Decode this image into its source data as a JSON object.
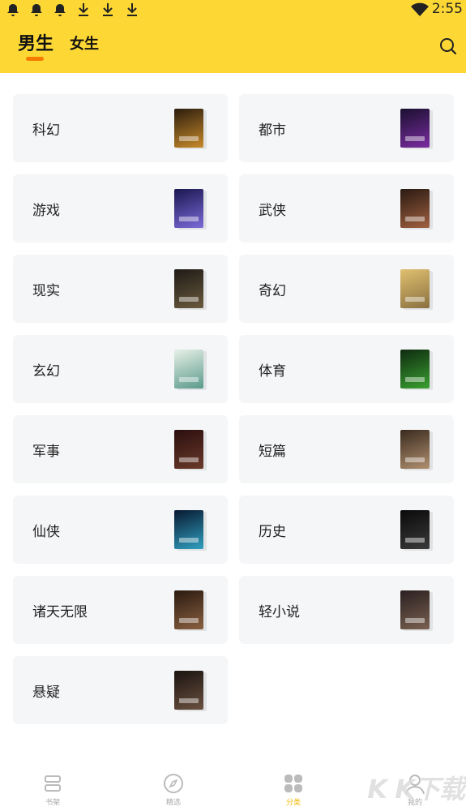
{
  "statusbar": {
    "time": "2:55"
  },
  "tabs": {
    "male": "男生",
    "female": "女生",
    "active": "male"
  },
  "colors": {
    "header": "#FDD835",
    "indicator": "#F57C00",
    "card": "#F5F6F8",
    "active_nav": "#F5B800"
  },
  "categories": [
    {
      "label": "科幻",
      "cover": [
        "#2b1d0e",
        "#c88a2a"
      ]
    },
    {
      "label": "都市",
      "cover": [
        "#1a1030",
        "#7a2ca0"
      ]
    },
    {
      "label": "游戏",
      "cover": [
        "#1b1750",
        "#7a6ad8"
      ]
    },
    {
      "label": "武侠",
      "cover": [
        "#2a1a12",
        "#a06040"
      ]
    },
    {
      "label": "现实",
      "cover": [
        "#1e1a16",
        "#6a5a3e"
      ]
    },
    {
      "label": "奇幻",
      "cover": [
        "#e0c070",
        "#8a7040"
      ]
    },
    {
      "label": "玄幻",
      "cover": [
        "#e8f0e8",
        "#5a9a8a"
      ]
    },
    {
      "label": "体育",
      "cover": [
        "#0e2a10",
        "#3aa030"
      ]
    },
    {
      "label": "军事",
      "cover": [
        "#2a0e0e",
        "#6a3a2a"
      ]
    },
    {
      "label": "短篇",
      "cover": [
        "#3a2a1e",
        "#b09070"
      ]
    },
    {
      "label": "仙侠",
      "cover": [
        "#081830",
        "#30a0c0"
      ]
    },
    {
      "label": "历史",
      "cover": [
        "#0a0a0a",
        "#3a3a3a"
      ]
    },
    {
      "label": "诸天无限",
      "cover": [
        "#2a1a10",
        "#8a6040"
      ]
    },
    {
      "label": "轻小说",
      "cover": [
        "#2a2020",
        "#7a6050"
      ]
    },
    {
      "label": "悬疑",
      "cover": [
        "#1a1410",
        "#6a5040"
      ]
    }
  ],
  "bottom_nav": [
    {
      "label": "书架",
      "icon": "bookshelf-icon",
      "active": false
    },
    {
      "label": "精选",
      "icon": "compass-icon",
      "active": false
    },
    {
      "label": "分类",
      "icon": "category-grid-icon",
      "active": true
    },
    {
      "label": "我的",
      "icon": "profile-icon",
      "active": false
    }
  ],
  "watermark": "K K下载"
}
